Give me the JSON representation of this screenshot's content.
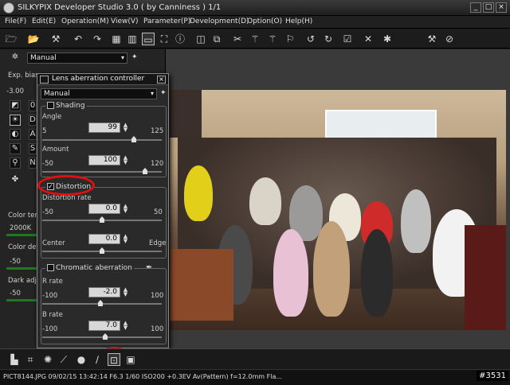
{
  "window": {
    "title": "SILKYPIX Developer Studio 3.0 ( by Canniness )   1/1"
  },
  "menu": [
    "File(F)",
    "Edit(E)",
    "Operation(M)",
    "View(V)",
    "Parameter(P)",
    "Development(D)",
    "Option(O)",
    "Help(H)"
  ],
  "left": {
    "preset": "Manual",
    "exp_bias_label": "Exp. bias",
    "exp_bias_value": "-3.00",
    "color_temp_label": "Color tem",
    "color_temp_value": "2000K",
    "color_def_label": "Color def",
    "color_def_value": "-50",
    "dark_adj_label": "Dark adj",
    "dark_adj_value": "-50"
  },
  "dialog": {
    "title": "Lens aberration controller",
    "preset": "Manual",
    "shading": {
      "label": "Shading",
      "angle_label": "Angle",
      "angle_min": "5",
      "angle_value": "99",
      "angle_max": "125",
      "amount_label": "Amount",
      "amount_min": "-50",
      "amount_value": "100",
      "amount_max": "120"
    },
    "distortion": {
      "label": "Distortion",
      "checked": true,
      "rate_label": "Distortion rate",
      "rate_min": "-50",
      "rate_value": "0.0",
      "rate_max": "50",
      "center_label": "Center",
      "center_value": "0.0",
      "edge_label": "Edge"
    },
    "chromatic": {
      "label": "Chromatic aberration",
      "r_label": "R rate",
      "r_min": "-100",
      "r_value": "-2.0",
      "r_max": "100",
      "b_label": "B rate",
      "b_min": "-100",
      "b_value": "7.0",
      "b_max": "100"
    }
  },
  "status": {
    "text": "PICT8144.JPG 09/02/15 13:42:14 F6.3 1/60 ISO200 +0.3EV Av(Pattern) f=12.0mm Fla..."
  },
  "badge": "#3531",
  "colors": {
    "highlight_ring": "#e01010",
    "slider_green": "#1e7a1e"
  }
}
